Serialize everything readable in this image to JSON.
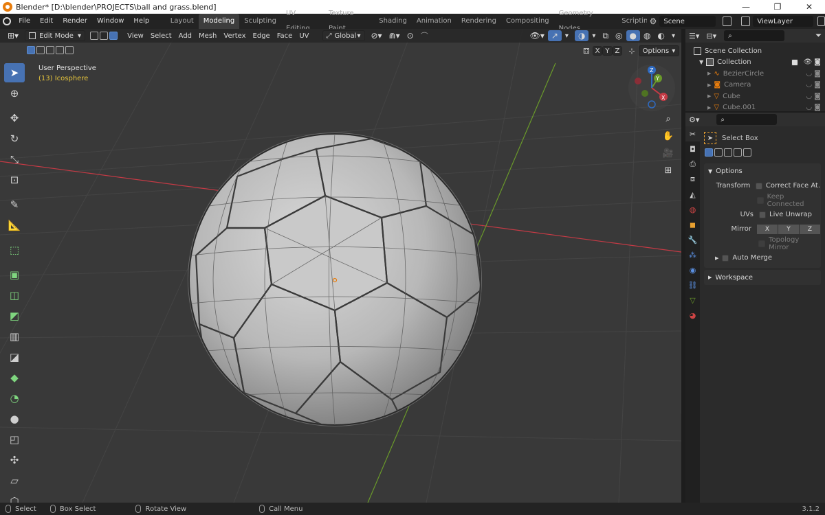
{
  "window": {
    "title": "Blender* [D:\\blender\\PROJECTS\\ball and grass.blend]",
    "minimize": "—",
    "maximize": "❐",
    "close": "✕"
  },
  "menu": {
    "items": [
      "File",
      "Edit",
      "Render",
      "Window",
      "Help"
    ],
    "workspaces": [
      "Layout",
      "Modeling",
      "Sculpting",
      "UV Editing",
      "Texture Paint",
      "Shading",
      "Animation",
      "Rendering",
      "Compositing",
      "Geometry Nodes",
      "Scripting"
    ],
    "active_workspace": "Modeling",
    "scene": "Scene",
    "view_layer": "ViewLayer"
  },
  "viewport_header": {
    "mode": "Edit Mode",
    "menus": [
      "View",
      "Select",
      "Add",
      "Mesh",
      "Vertex",
      "Edge",
      "Face",
      "UV"
    ],
    "orientation": "Global",
    "options_label": "Options",
    "axis_x": "X",
    "axis_y": "Y",
    "axis_z": "Z"
  },
  "viewport": {
    "view_name": "User Perspective",
    "object_name": "(13) Icosphere",
    "gizmo_x": "X",
    "gizmo_y": "Y",
    "gizmo_z": "Z"
  },
  "outliner": {
    "root": "Scene Collection",
    "collection": "Collection",
    "items": [
      "BezierCircle",
      "Camera",
      "Cube",
      "Cube.001"
    ]
  },
  "properties": {
    "tool_name": "Select Box",
    "options_panel": "Options",
    "transform_label": "Transform",
    "correct_face": "Correct Face At...",
    "keep_connected": "Keep Connected",
    "uvs_label": "UVs",
    "live_unwrap": "Live Unwrap",
    "mirror_label": "Mirror",
    "mirror_x": "X",
    "mirror_y": "Y",
    "mirror_z": "Z",
    "topology_mirror": "Topology Mirror",
    "auto_merge": "Auto Merge",
    "workspace_panel": "Workspace"
  },
  "statusbar": {
    "select": "Select",
    "box_select": "Box Select",
    "rotate_view": "Rotate View",
    "call_menu": "Call Menu",
    "version": "3.1.2"
  },
  "colors": {
    "accent": "#4772b3",
    "axis_x": "#c53a45",
    "axis_y": "#6a9a2a",
    "axis_z": "#2f6bc2",
    "viewport_bg": "#393939"
  }
}
